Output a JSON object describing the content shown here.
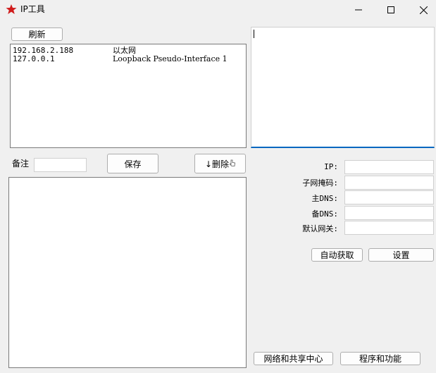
{
  "window": {
    "title": "IP工具",
    "icon": "red-star-icon",
    "controls": [
      "minimize-icon",
      "maximize-icon",
      "close-icon"
    ]
  },
  "toolbar": {
    "refresh_label": "刷新"
  },
  "adapter_list": {
    "rows": [
      {
        "ip": "192.168.2.188",
        "name": "以太网"
      },
      {
        "ip": "127.0.0.1",
        "name": "Loopback Pseudo-Interface 1"
      }
    ]
  },
  "notes": {
    "label": "备注",
    "value": "",
    "save_label": "保存",
    "delete_label": "↓删除"
  },
  "config_form": {
    "ip_label": "IP:",
    "mask_label": "子网掩码:",
    "dns1_label": "主DNS:",
    "dns2_label": "备DNS:",
    "gateway_label": "默认网关:",
    "ip_value": "",
    "mask_value": "",
    "dns1_value": "",
    "dns2_value": "",
    "gateway_value": ""
  },
  "actions": {
    "auto_label": "自动获取",
    "set_label": "设置",
    "network_center_label": "网络和共享中心",
    "programs_label": "程序和功能"
  },
  "colors": {
    "accent": "#0067c0",
    "icon_red": "#d01b1b"
  }
}
